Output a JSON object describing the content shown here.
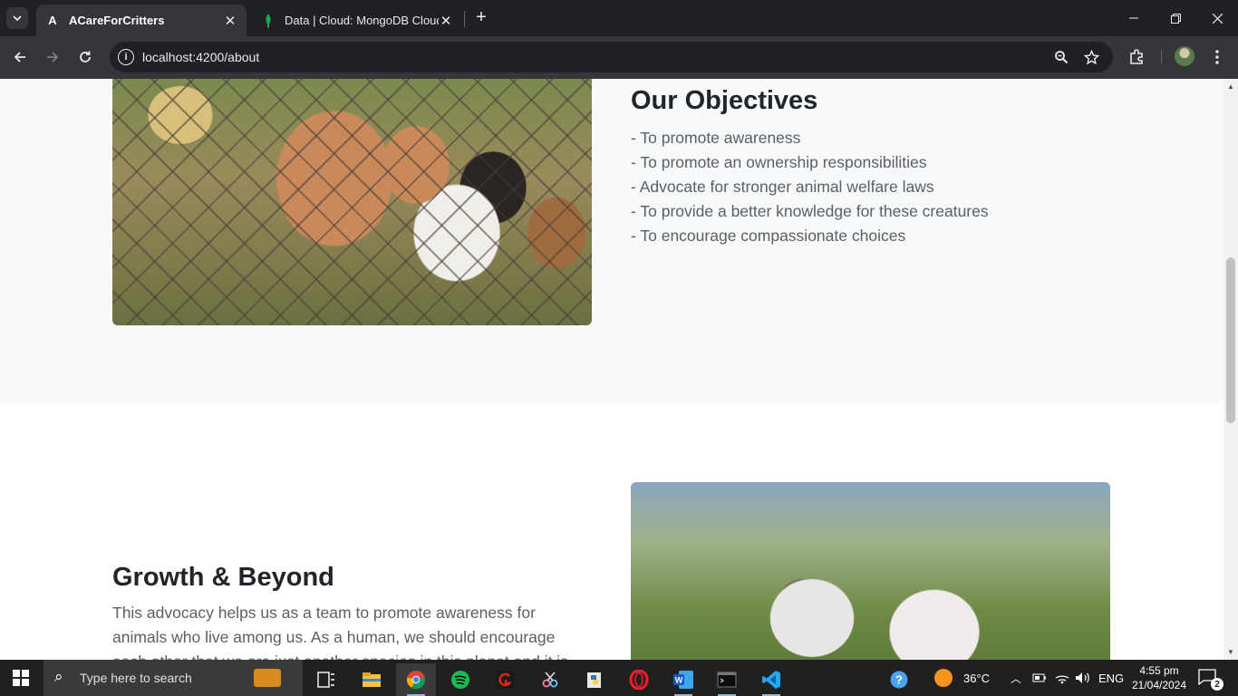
{
  "browser": {
    "tabs": [
      {
        "favicon": "A",
        "title": "ACareForCritters",
        "active": true
      },
      {
        "favicon": "mongodb-leaf-icon",
        "title": "Data | Cloud: MongoDB Cloud",
        "active": false
      }
    ],
    "url": "localhost:4200/about"
  },
  "page": {
    "objectives": {
      "title": "Our Objectives",
      "items": [
        "- To promote awareness",
        "- To promote an ownership responsibilities",
        "- Advocate for stronger animal welfare laws",
        "- To provide a better knowledge for these creatures",
        "- To encourage compassionate choices"
      ]
    },
    "growth": {
      "title": "Growth & Beyond",
      "text": "This advocacy helps us as a team to promote awareness for animals who live among us. As a human, we should encourage each other that we are just another species in this planet and it is"
    }
  },
  "taskbar": {
    "search_placeholder": "Type here to search",
    "weather": "36°C",
    "language": "ENG",
    "time": "4:55 pm",
    "date": "21/04/2024",
    "notifications": "2"
  }
}
